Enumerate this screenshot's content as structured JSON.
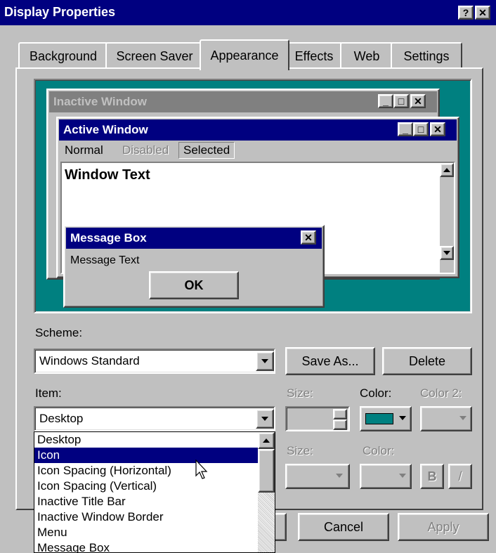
{
  "window": {
    "title": "Display Properties",
    "help_glyph": "?",
    "close_glyph": "✕"
  },
  "tabs": [
    "Background",
    "Screen Saver",
    "Appearance",
    "Effects",
    "Web",
    "Settings"
  ],
  "preview": {
    "inactive_title": "Inactive Window",
    "active_title": "Active Window",
    "menu": {
      "normal": "Normal",
      "disabled": "Disabled",
      "selected": "Selected"
    },
    "window_text": "Window Text",
    "msgbox": {
      "title": "Message Box",
      "text": "Message Text",
      "ok": "OK"
    },
    "desktop_color": "#008080"
  },
  "scheme": {
    "label": "Scheme:",
    "value": "Windows Standard",
    "save_as": "Save As...",
    "delete": "Delete"
  },
  "item": {
    "label": "Item:",
    "value": "Desktop",
    "size_label": "Size:",
    "color_label": "Color:",
    "color2_label": "Color 2:",
    "color_value": "#008080"
  },
  "font": {
    "size_label": "Size:",
    "color_label": "Color:",
    "bold": "B",
    "italic": "/"
  },
  "item_list": [
    "Desktop",
    "Icon",
    "Icon Spacing (Horizontal)",
    "Icon Spacing (Vertical)",
    "Inactive Title Bar",
    "Inactive Window Border",
    "Menu",
    "Message Box"
  ],
  "item_list_selected": "Icon",
  "footer": {
    "cancel": "Cancel",
    "apply": "Apply"
  }
}
